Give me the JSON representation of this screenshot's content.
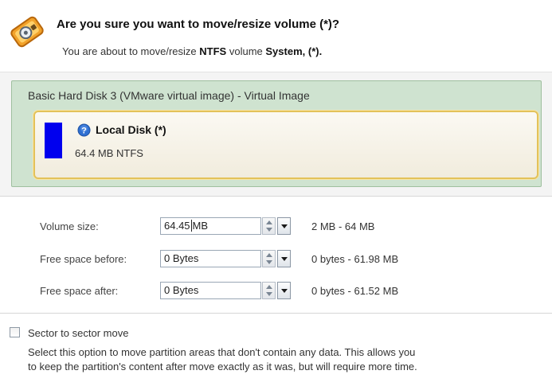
{
  "dialog": {
    "title": "Are you sure you want to move/resize volume (*)?",
    "subtitle_prefix": "You are about to move/resize",
    "subtitle_fs": "NTFS",
    "subtitle_mid": "volume",
    "subtitle_volume": "System, (*).",
    "icon": "disk-wrench-icon"
  },
  "disk": {
    "title": "Basic Hard Disk 3 (VMware virtual image) - Virtual Image",
    "volume": {
      "name": "Local Disk (*)",
      "size": "64.4 MB NTFS",
      "color": "#0000ee",
      "icon": "help-icon"
    }
  },
  "fields": [
    {
      "label": "Volume size:",
      "value": "64.45",
      "unit": "MB",
      "range": "2 MB - 64 MB"
    },
    {
      "label": "Free space before:",
      "value": "0 Bytes",
      "unit": "",
      "range": "0 bytes - 61.98 MB"
    },
    {
      "label": "Free space after:",
      "value": "0 Bytes",
      "unit": "",
      "range": "0 bytes - 61.52 MB"
    }
  ],
  "option": {
    "label": "Sector to sector move",
    "checked": false,
    "description_line1": "Select this option to move partition areas that don't contain any data. This allows you",
    "description_line2": "to keep the partition's content after move exactly as it was, but will require more time."
  }
}
